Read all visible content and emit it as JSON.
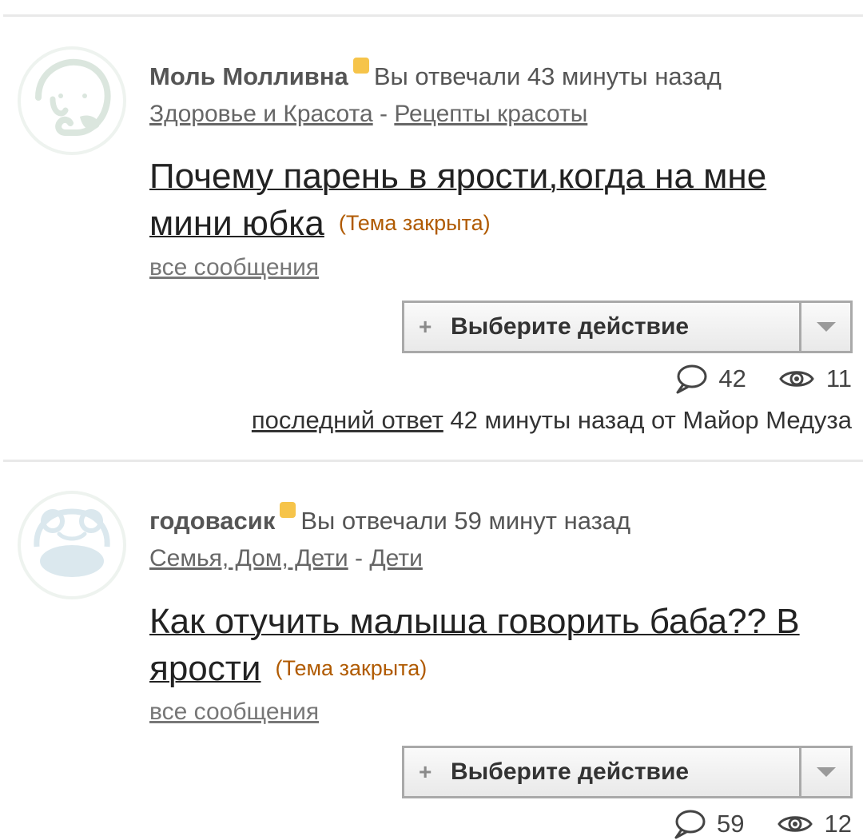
{
  "posts": [
    {
      "author": "Моль Молливна",
      "replied": "Вы отвечали 43 минуты назад",
      "category": "Здоровье и Красота",
      "separator": "-",
      "subcategory": "Рецепты красоты",
      "title": "Почему парень в ярости,когда на мне мини юбка",
      "closed": "(Тема закрыта)",
      "all_messages": "все сообщения",
      "action_label": "Выберите действие",
      "comments": "42",
      "views": "11",
      "last_reply_link": "последний ответ",
      "last_reply_text": "42 минуты назад от Майор Медуза",
      "avatar_icon": "elephant-avatar-icon"
    },
    {
      "author": "годовасик",
      "replied": "Вы отвечали 59 минут назад",
      "category": "Семья, Дом, Дети",
      "separator": "-",
      "subcategory": "Дети",
      "title": "Как отучить малыша говорить баба?? В ярости",
      "closed": "(Тема закрыта)",
      "all_messages": "все сообщения",
      "action_label": "Выберите действие",
      "comments": "59",
      "views": "12",
      "avatar_icon": "frog-avatar-icon"
    }
  ],
  "colors": {
    "status_dot": "#f6c44a",
    "closed_text": "#b05a00",
    "divider": "#e9e9e9"
  }
}
